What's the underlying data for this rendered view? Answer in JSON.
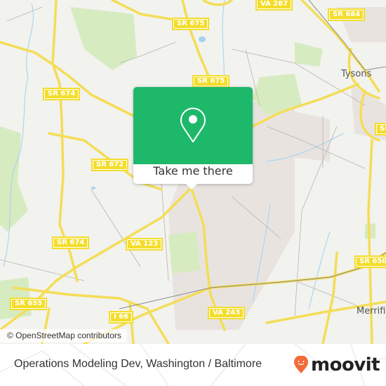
{
  "map": {
    "road_labels": [
      {
        "id": "va-267",
        "text": "VA 267"
      },
      {
        "id": "sr-684",
        "text": "SR 684"
      },
      {
        "id": "sr-675-a",
        "text": "SR 675"
      },
      {
        "id": "sr-675-b",
        "text": "SR 675"
      },
      {
        "id": "sr-674-a",
        "text": "SR 674"
      },
      {
        "id": "sr-672",
        "text": "SR 672"
      },
      {
        "id": "sr-674-b",
        "text": "SR 674"
      },
      {
        "id": "va-123",
        "text": "VA 123"
      },
      {
        "id": "sr-650",
        "text": "SR 650"
      },
      {
        "id": "sr-655",
        "text": "SR 655"
      },
      {
        "id": "i-66",
        "text": "I 66"
      },
      {
        "id": "va-243",
        "text": "VA 243"
      },
      {
        "id": "sr-edge",
        "text": "SR"
      }
    ],
    "place_labels": [
      {
        "id": "tysons",
        "text": "Tysons"
      },
      {
        "id": "merrifield",
        "text": "Merrifie"
      }
    ],
    "attribution": "© OpenStreetMap contributors",
    "colors": {
      "land": "#f2f2ee",
      "park": "#d7ebc0",
      "urban": "#e9e3e0",
      "road": "#f4dd57",
      "water": "#9fd3f0"
    }
  },
  "popup": {
    "icon": "map-pin-icon",
    "button_label": "Take me there",
    "accent": "#1eb86a"
  },
  "footer": {
    "title": "Operations Modeling Dev, Washington / Baltimore",
    "brand": "moovit",
    "brand_color": "#f26b3a"
  }
}
